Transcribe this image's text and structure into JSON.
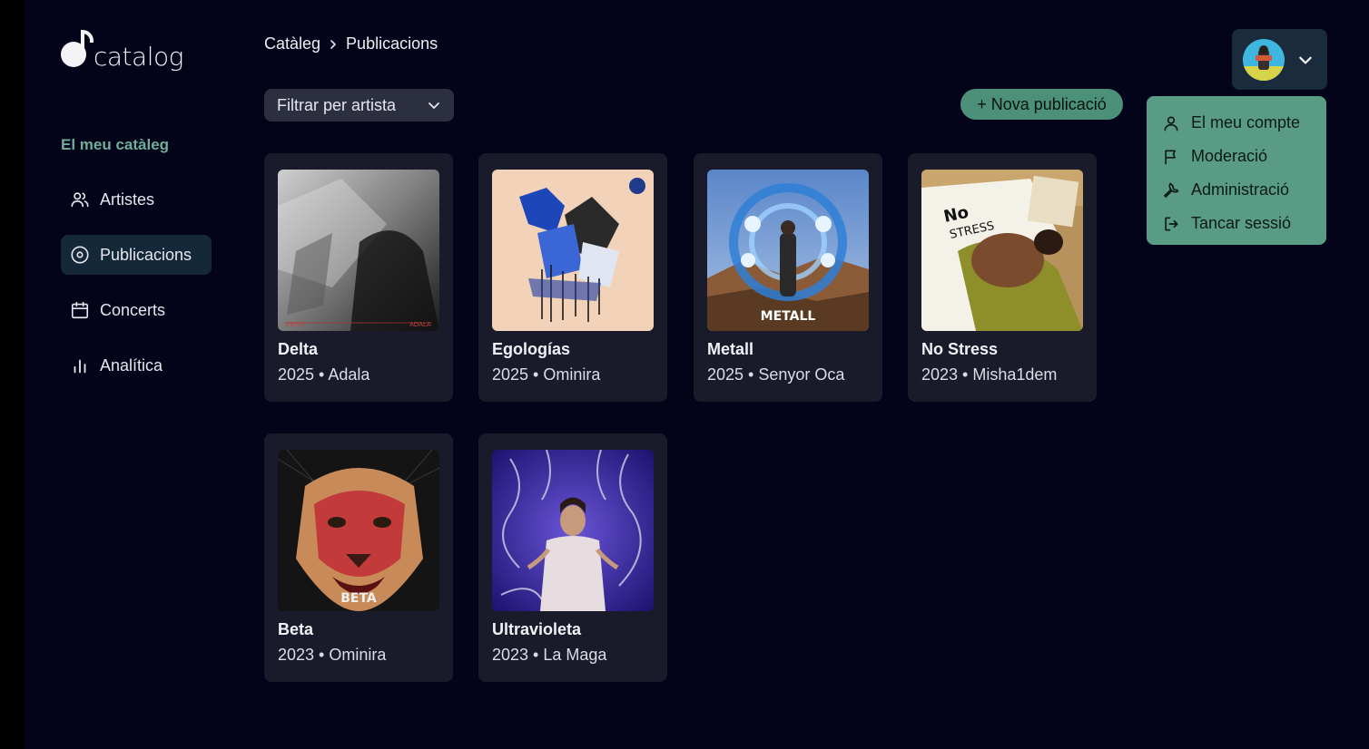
{
  "logo": {
    "text": "catalog"
  },
  "sidebar": {
    "heading": "El meu catàleg",
    "items": [
      {
        "label": "Artistes",
        "icon": "users-icon",
        "active": false
      },
      {
        "label": "Publicacions",
        "icon": "disc-icon",
        "active": true
      },
      {
        "label": "Concerts",
        "icon": "calendar-icon",
        "active": false
      },
      {
        "label": "Analítica",
        "icon": "bar-chart-icon",
        "active": false
      }
    ]
  },
  "breadcrumb": {
    "root": "Catàleg",
    "current": "Publicacions"
  },
  "filter": {
    "value": "Filtrar per artista"
  },
  "new_button": {
    "label": "+ Nova publicació"
  },
  "releases": [
    {
      "title": "Delta",
      "meta": "2025 • Adala",
      "cover_labels": [
        "DELTA",
        "ADALA"
      ]
    },
    {
      "title": "Egologías",
      "meta": "2025 • Ominira"
    },
    {
      "title": "Metall",
      "meta": "2025 • Senyor Oca",
      "cover_labels": [
        "METALL"
      ]
    },
    {
      "title": "No Stress",
      "meta": "2023 • Misha1dem",
      "cover_labels": [
        "No",
        "STRESS"
      ]
    },
    {
      "title": "Beta",
      "meta": "2023 • Ominira",
      "cover_labels": [
        "BETA"
      ]
    },
    {
      "title": "Ultravioleta",
      "meta": "2023 • La Maga"
    }
  ],
  "user_menu": {
    "items": [
      {
        "label": "El meu compte",
        "icon": "user-icon"
      },
      {
        "label": "Moderació",
        "icon": "flag-icon"
      },
      {
        "label": "Administració",
        "icon": "wrench-icon"
      },
      {
        "label": "Tancar sessió",
        "icon": "logout-icon"
      }
    ]
  },
  "colors": {
    "background": "#03041a",
    "accent": "#4c907a",
    "dropdown": "#5a9b86",
    "card": "#191b2b"
  }
}
